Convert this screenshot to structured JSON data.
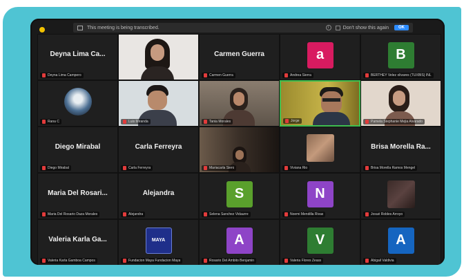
{
  "notice": {
    "text": "This meeting is being transcribed.",
    "dont_show": "Don't show this again",
    "ok": "OK"
  },
  "tiles": [
    {
      "type": "name",
      "name": "Deyna Lima Ca...",
      "label": "Deyna Lima Campero"
    },
    {
      "type": "video",
      "label": "",
      "scene": "woman-glasses"
    },
    {
      "type": "name",
      "name": "Carmen Guerra",
      "label": "Carmen Guerra"
    },
    {
      "type": "avatar",
      "letter": "a",
      "color": "#d81b60",
      "label": "Andrea Sierra"
    },
    {
      "type": "avatar",
      "letter": "B",
      "color": "#2e7d32",
      "label": "BERTHEY Velez olivares (TUXBIS) INL"
    },
    {
      "type": "photo",
      "label": "Rana C",
      "scene": "round-photo"
    },
    {
      "type": "video",
      "label": "Luis Miranda",
      "scene": "man-young"
    },
    {
      "type": "video",
      "label": "Tania Morales",
      "scene": "woman-room"
    },
    {
      "type": "video",
      "label": "Jorge",
      "scene": "man-glasses",
      "active": true
    },
    {
      "type": "video",
      "label": "Pamela Stephanie Mejia Alvarado",
      "scene": "woman-side"
    },
    {
      "type": "name",
      "name": "Diego Mirabal",
      "label": "Diego Mirabal"
    },
    {
      "type": "name",
      "name": "Carla Ferreyra",
      "label": "Carla Ferreyra"
    },
    {
      "type": "video",
      "label": "Mariacarla Siero",
      "scene": "dark-room"
    },
    {
      "type": "photo",
      "label": "Viviana Rio",
      "scene": "brown-photo"
    },
    {
      "type": "name",
      "name": "Brisa Morella Ra...",
      "label": "Brisa Morella Ramos Mengel"
    },
    {
      "type": "name",
      "name": "Maria Del Rosari...",
      "label": "Maria Del Rosario Daza Morales"
    },
    {
      "type": "name",
      "name": "Alejandra",
      "label": "Alejandra"
    },
    {
      "type": "avatar",
      "letter": "S",
      "color": "#5aa02c",
      "label": "Selena Sanchez Vidaurre"
    },
    {
      "type": "avatar",
      "letter": "N",
      "color": "#8e44c7",
      "label": "Noemi Mendilla Rivas"
    },
    {
      "type": "photo",
      "label": "Josué Robles Arroyo",
      "scene": "dark-photo"
    },
    {
      "type": "name",
      "name": "Valeria Karla Ga...",
      "label": "Valeria Karla Gamboa Campos"
    },
    {
      "type": "logo",
      "label": "Fundacion Maya Fundacion Maya",
      "logo_text": "MAYA"
    },
    {
      "type": "avatar",
      "letter": "A",
      "color": "#8e44c7",
      "label": "Rosario Del Ambito Benjamin"
    },
    {
      "type": "avatar",
      "letter": "V",
      "color": "#2e7d32",
      "label": "Valeria Flores Zeass"
    },
    {
      "type": "avatar",
      "letter": "A",
      "color": "#1565c0",
      "label": "Abigail Valdivia"
    }
  ]
}
